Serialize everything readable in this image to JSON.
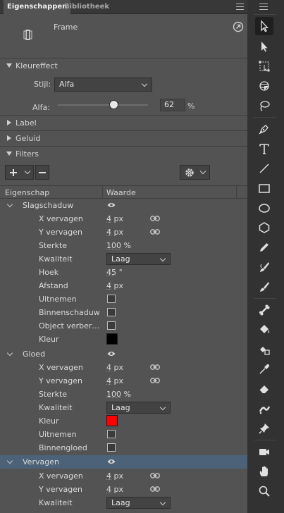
{
  "tabs": [
    {
      "label": "Eigenschappen",
      "active": true
    },
    {
      "label": "Bibliotheek",
      "active": false
    }
  ],
  "doc": {
    "type_label": "Frame"
  },
  "color_effect": {
    "title": "Kleureffect",
    "style_label": "Stijl:",
    "style_value": "Alfa",
    "alpha_label": "Alfa:",
    "alpha_value": "62",
    "alpha_unit": "%",
    "alpha_fraction": 0.62
  },
  "sections": {
    "label": "Label",
    "sound": "Geluid",
    "filters": "Filters"
  },
  "columns": {
    "property": "Eigenschap",
    "value": "Waarde"
  },
  "filters": {
    "dropshadow": {
      "name": "Slagschaduw",
      "x_label": "X vervagen",
      "x_value": "4",
      "x_unit": "px",
      "y_label": "Y vervagen",
      "y_value": "4",
      "y_unit": "px",
      "strength_label": "Sterkte",
      "strength_value": "100",
      "strength_unit": "%",
      "quality_label": "Kwaliteit",
      "quality_value": "Laag",
      "angle_label": "Hoek",
      "angle_value": "45",
      "angle_unit": "°",
      "distance_label": "Afstand",
      "distance_value": "4",
      "distance_unit": "px",
      "knockout_label": "Uitnemen",
      "inner_label": "Binnenschaduw",
      "hide_label": "Object verber…",
      "color_label": "Kleur",
      "color": "#000000"
    },
    "glow": {
      "name": "Gloed",
      "x_label": "X vervagen",
      "x_value": "4",
      "x_unit": "px",
      "y_label": "Y vervagen",
      "y_value": "4",
      "y_unit": "px",
      "strength_label": "Sterkte",
      "strength_value": "100",
      "strength_unit": "%",
      "quality_label": "Kwaliteit",
      "quality_value": "Laag",
      "color_label": "Kleur",
      "color": "#ff0000",
      "knockout_label": "Uitnemen",
      "inner_label": "Binnengloed"
    },
    "blur": {
      "name": "Vervagen",
      "x_label": "X vervagen",
      "x_value": "4",
      "x_unit": "px",
      "y_label": "Y vervagen",
      "y_value": "4",
      "y_unit": "px",
      "quality_label": "Kwaliteit",
      "quality_value": "Laag"
    }
  },
  "colors": {
    "selection": "#4c6278",
    "panel": "#535353"
  },
  "tools": [
    "selection-tool-icon",
    "subselection-tool-icon",
    "free-transform-icon",
    "3d-rotation-icon",
    "lasso-icon",
    "pen-icon",
    "text-icon",
    "line-icon",
    "rectangle-icon",
    "oval-icon",
    "polystar-icon",
    "pencil-icon",
    "paint-brush-icon",
    "brush-icon",
    "bone-icon",
    "paint-bucket-icon",
    "ink-bottle-icon",
    "eyedropper-icon",
    "eraser-icon",
    "width-tool-icon",
    "pin-icon",
    "camera-icon",
    "hand-icon",
    "zoom-icon"
  ]
}
